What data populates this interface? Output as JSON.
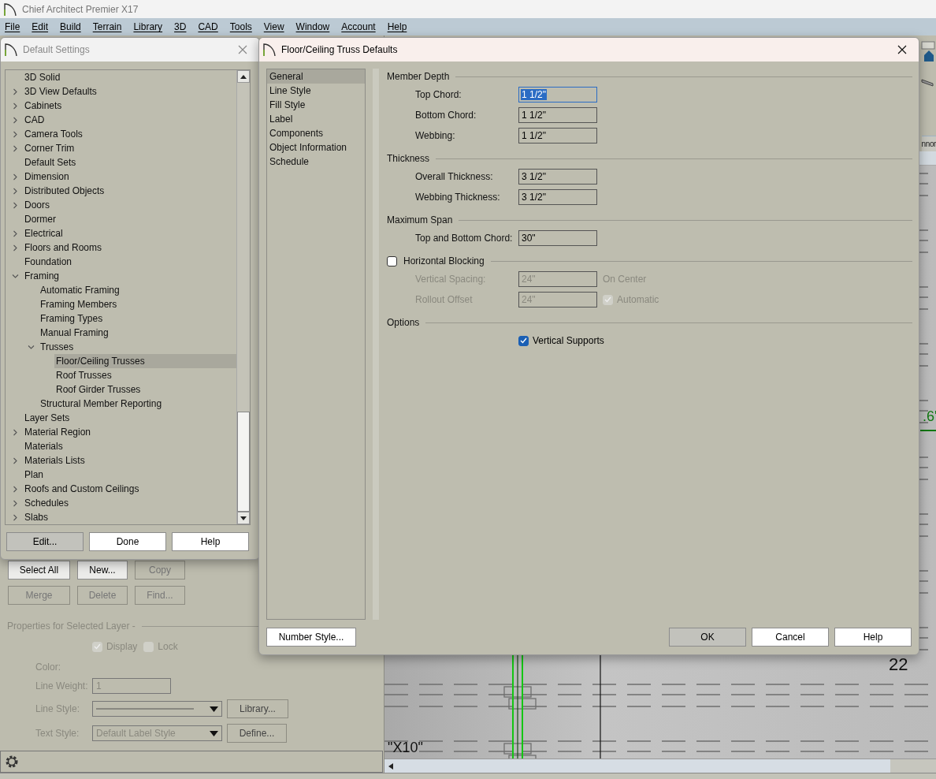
{
  "app": {
    "title": "Chief Architect Premier X17"
  },
  "menu": [
    "File",
    "Edit",
    "Build",
    "Terrain",
    "Library",
    "3D",
    "CAD",
    "Tools",
    "View",
    "Window",
    "Account",
    "Help"
  ],
  "canvas": {
    "tab_label": "nnor",
    "labels": [
      {
        "kind": "dimension",
        "text": ".6'"
      },
      {
        "kind": "number",
        "text": "22"
      },
      {
        "kind": "tag",
        "text": "\"X10\""
      }
    ]
  },
  "layer_panel": {
    "buttons": [
      {
        "label": "Select All",
        "disabled": false
      },
      {
        "label": "New...",
        "disabled": false
      },
      {
        "label": "Copy",
        "disabled": true
      },
      {
        "label": "Merge",
        "disabled": true
      },
      {
        "label": "Delete",
        "disabled": true
      },
      {
        "label": "Find...",
        "disabled": true
      }
    ],
    "properties": {
      "title": "Properties for Selected Layer -",
      "disabled": true,
      "display": {
        "label": "Display",
        "checked": true
      },
      "lock": {
        "label": "Lock",
        "checked": false
      },
      "color_label": "Color:",
      "line_weight": {
        "label": "Line Weight:",
        "value": "1"
      },
      "line_style": {
        "label": "Line Style:",
        "button": "Library..."
      },
      "text_style": {
        "label": "Text Style:",
        "value": "Default Label Style",
        "button": "Define..."
      }
    }
  },
  "default_settings": {
    "title": "Default Settings",
    "tree": [
      {
        "label": "3D Solid",
        "kind": "leaf",
        "selected": false
      },
      {
        "label": "3D View Defaults",
        "kind": "branch",
        "expanded": false,
        "selected": false
      },
      {
        "label": "Cabinets",
        "kind": "branch",
        "expanded": false,
        "selected": false
      },
      {
        "label": "CAD",
        "kind": "branch",
        "expanded": false,
        "selected": false
      },
      {
        "label": "Camera Tools",
        "kind": "branch",
        "expanded": false,
        "selected": false
      },
      {
        "label": "Corner Trim",
        "kind": "branch",
        "expanded": false,
        "selected": false
      },
      {
        "label": "Default Sets",
        "kind": "leaf",
        "selected": false
      },
      {
        "label": "Dimension",
        "kind": "branch",
        "expanded": false,
        "selected": false
      },
      {
        "label": "Distributed Objects",
        "kind": "branch",
        "expanded": false,
        "selected": false
      },
      {
        "label": "Doors",
        "kind": "branch",
        "expanded": false,
        "selected": false
      },
      {
        "label": "Dormer",
        "kind": "leaf",
        "selected": false
      },
      {
        "label": "Electrical",
        "kind": "branch",
        "expanded": false,
        "selected": false
      },
      {
        "label": "Floors and Rooms",
        "kind": "branch",
        "expanded": false,
        "selected": false
      },
      {
        "label": "Foundation",
        "kind": "leaf",
        "selected": false
      },
      {
        "label": "Framing",
        "kind": "branch",
        "expanded": true,
        "selected": false,
        "children": [
          {
            "label": "Automatic Framing",
            "kind": "leaf",
            "selected": false
          },
          {
            "label": "Framing Members",
            "kind": "leaf",
            "selected": false
          },
          {
            "label": "Framing Types",
            "kind": "leaf",
            "selected": false
          },
          {
            "label": "Manual Framing",
            "kind": "leaf",
            "selected": false
          },
          {
            "label": "Trusses",
            "kind": "branch",
            "expanded": true,
            "selected": false,
            "children": [
              {
                "label": "Floor/Ceiling Trusses",
                "kind": "leaf",
                "selected": true
              },
              {
                "label": "Roof Trusses",
                "kind": "leaf",
                "selected": false
              },
              {
                "label": "Roof Girder Trusses",
                "kind": "leaf",
                "selected": false
              }
            ]
          },
          {
            "label": "Structural Member Reporting",
            "kind": "leaf",
            "selected": false
          }
        ]
      },
      {
        "label": "Layer Sets",
        "kind": "leaf",
        "selected": false
      },
      {
        "label": "Material Region",
        "kind": "branch",
        "expanded": false,
        "selected": false
      },
      {
        "label": "Materials",
        "kind": "leaf",
        "selected": false
      },
      {
        "label": "Materials Lists",
        "kind": "branch",
        "expanded": false,
        "selected": false
      },
      {
        "label": "Plan",
        "kind": "leaf",
        "selected": false
      },
      {
        "label": "Roofs and Custom Ceilings",
        "kind": "branch",
        "expanded": false,
        "selected": false
      },
      {
        "label": "Schedules",
        "kind": "branch",
        "expanded": false,
        "selected": false
      },
      {
        "label": "Slabs",
        "kind": "branch",
        "expanded": false,
        "selected": false
      }
    ],
    "buttons": [
      {
        "label": "Edit...",
        "default": true
      },
      {
        "label": "Done",
        "default": false
      },
      {
        "label": "Help",
        "default": false
      }
    ]
  },
  "truss_dialog": {
    "title": "Floor/Ceiling Truss Defaults",
    "nav": [
      {
        "label": "General",
        "selected": true
      },
      {
        "label": "Line Style",
        "selected": false
      },
      {
        "label": "Fill Style",
        "selected": false
      },
      {
        "label": "Label",
        "selected": false
      },
      {
        "label": "Components",
        "selected": false
      },
      {
        "label": "Object Information",
        "selected": false
      },
      {
        "label": "Schedule",
        "selected": false
      }
    ],
    "sections": [
      {
        "title": "Member Depth",
        "rows": [
          {
            "kind": "field",
            "label": "Top Chord:",
            "value": "1 1/2\"",
            "disabled": false,
            "focused": true
          },
          {
            "kind": "field",
            "label": "Bottom Chord:",
            "value": "1 1/2\"",
            "disabled": false,
            "focused": false
          },
          {
            "kind": "field",
            "label": "Webbing:",
            "value": "1 1/2\"",
            "disabled": false,
            "focused": false
          }
        ]
      },
      {
        "title": "Thickness",
        "rows": [
          {
            "kind": "field",
            "label": "Overall Thickness:",
            "value": "3 1/2\"",
            "disabled": false,
            "focused": false
          },
          {
            "kind": "field",
            "label": "Webbing Thickness:",
            "value": "3 1/2\"",
            "disabled": false,
            "focused": false
          }
        ]
      },
      {
        "title": "Maximum Span",
        "rows": [
          {
            "kind": "field",
            "label": "Top and Bottom Chord:",
            "value": "30\"",
            "disabled": false,
            "focused": false
          }
        ]
      },
      {
        "title": "Horizontal Blocking",
        "checked": false,
        "rows": [
          {
            "kind": "field",
            "label": "Vertical Spacing:",
            "value": "24\"",
            "disabled": true,
            "focused": false,
            "note": "On Center"
          },
          {
            "kind": "field",
            "label": "Rollout Offset",
            "value": "24\"",
            "disabled": true,
            "focused": false,
            "option": {
              "label": "Automatic",
              "checked": true
            }
          }
        ]
      },
      {
        "title": "Options",
        "rows": [
          {
            "kind": "checkbox",
            "label": "Vertical Supports",
            "checked": true,
            "disabled": false
          }
        ]
      }
    ],
    "number_style_button": "Number Style...",
    "buttons": [
      {
        "label": "OK",
        "default": true
      },
      {
        "label": "Cancel",
        "default": false
      },
      {
        "label": "Help",
        "default": false
      }
    ]
  }
}
